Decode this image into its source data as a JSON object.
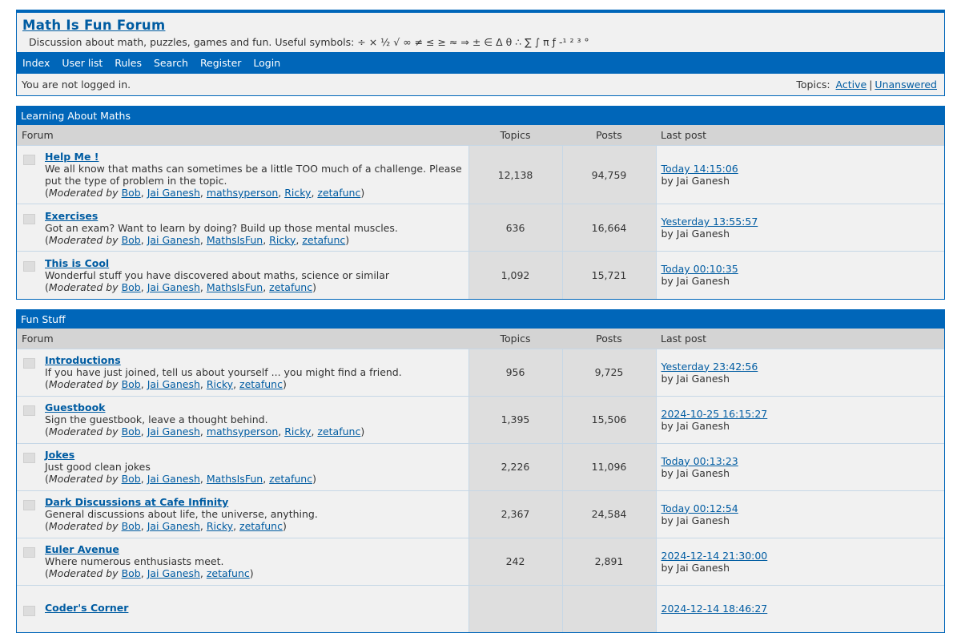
{
  "header": {
    "title": "Math Is Fun Forum",
    "description": "Discussion about math, puzzles, games and fun.   Useful symbols: ÷ × ½ √ ∞ ≠ ≤ ≥ ≈ ⇒ ± ∈ Δ θ ∴ ∑ ∫  π ƒ -¹ ² ³ °"
  },
  "nav": [
    "Index",
    "User list",
    "Rules",
    "Search",
    "Register",
    "Login"
  ],
  "status": {
    "login_text": "You are not logged in.",
    "topics_label": "Topics:",
    "active": "Active",
    "separator": "|",
    "unanswered": "Unanswered"
  },
  "columns": {
    "forum": "Forum",
    "topics": "Topics",
    "posts": "Posts",
    "last_post": "Last post"
  },
  "moderated_prefix": "Moderated by",
  "categories": [
    {
      "name": "Learning About Maths",
      "forums": [
        {
          "name": "Help Me !",
          "desc": "We all know that maths can sometimes be a little TOO much of a challenge. Please put the type of problem in the topic.",
          "mods": [
            "Bob",
            "Jai Ganesh",
            "mathsyperson",
            "Ricky",
            "zetafunc"
          ],
          "topics": "12,138",
          "posts": "94,759",
          "last_post": "Today 14:15:06",
          "last_by": "by Jai Ganesh"
        },
        {
          "name": "Exercises",
          "desc": "Got an exam? Want to learn by doing? Build up those mental muscles.",
          "mods": [
            "Bob",
            "Jai Ganesh",
            "MathsIsFun",
            "Ricky",
            "zetafunc"
          ],
          "topics": "636",
          "posts": "16,664",
          "last_post": "Yesterday 13:55:57",
          "last_by": "by Jai Ganesh"
        },
        {
          "name": "This is Cool",
          "desc": "Wonderful stuff you have discovered about maths, science or similar",
          "mods": [
            "Bob",
            "Jai Ganesh",
            "MathsIsFun",
            "zetafunc"
          ],
          "topics": "1,092",
          "posts": "15,721",
          "last_post": "Today 00:10:35",
          "last_by": "by Jai Ganesh"
        }
      ]
    },
    {
      "name": "Fun Stuff",
      "forums": [
        {
          "name": "Introductions",
          "desc": "If you have just joined, tell us about yourself ... you might find a friend.",
          "mods": [
            "Bob",
            "Jai Ganesh",
            "Ricky",
            "zetafunc"
          ],
          "topics": "956",
          "posts": "9,725",
          "last_post": "Yesterday 23:42:56",
          "last_by": "by Jai Ganesh"
        },
        {
          "name": "Guestbook",
          "desc": "Sign the guestbook, leave a thought behind.",
          "mods": [
            "Bob",
            "Jai Ganesh",
            "mathsyperson",
            "Ricky",
            "zetafunc"
          ],
          "topics": "1,395",
          "posts": "15,506",
          "last_post": "2024-10-25 16:15:27",
          "last_by": "by Jai Ganesh"
        },
        {
          "name": "Jokes",
          "desc": "Just good clean jokes",
          "mods": [
            "Bob",
            "Jai Ganesh",
            "MathsIsFun",
            "zetafunc"
          ],
          "topics": "2,226",
          "posts": "11,096",
          "last_post": "Today 00:13:23",
          "last_by": "by Jai Ganesh"
        },
        {
          "name": "Dark Discussions at Cafe Infinity",
          "desc": "General discussions about life, the universe, anything.",
          "mods": [
            "Bob",
            "Jai Ganesh",
            "Ricky",
            "zetafunc"
          ],
          "topics": "2,367",
          "posts": "24,584",
          "last_post": "Today 00:12:54",
          "last_by": "by Jai Ganesh"
        },
        {
          "name": "Euler Avenue",
          "desc": "Where numerous enthusiasts meet.",
          "mods": [
            "Bob",
            "Jai Ganesh",
            "zetafunc"
          ],
          "topics": "242",
          "posts": "2,891",
          "last_post": "2024-12-14 21:30:00",
          "last_by": "by Jai Ganesh"
        },
        {
          "name": "Coder's Corner",
          "desc": "",
          "mods": [],
          "topics": "",
          "posts": "",
          "last_post": "2024-12-14 18:46:27",
          "last_by": ""
        }
      ]
    }
  ]
}
